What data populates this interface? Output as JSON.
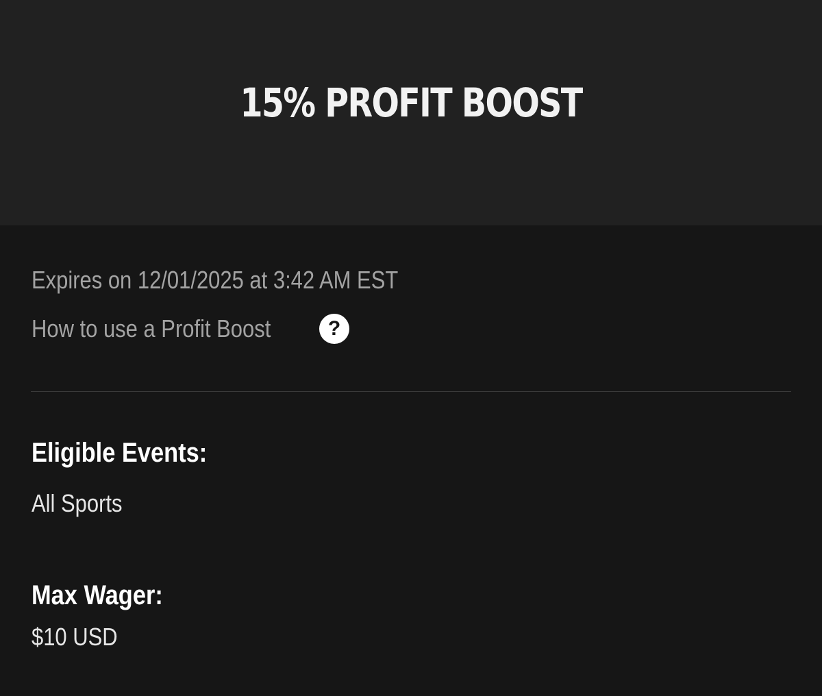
{
  "header": {
    "title": "15% PROFIT BOOST"
  },
  "details": {
    "expires_text": "Expires on 12/01/2025 at 3:42 AM EST",
    "how_to_text": "How to use a Profit Boost",
    "help_icon_glyph": "?",
    "help_icon_name": "question-circle-icon"
  },
  "eligible_events": {
    "label": "Eligible Events:",
    "value": "All Sports"
  },
  "max_wager": {
    "label": "Max Wager:",
    "value": "$10 USD"
  },
  "colors": {
    "header_bg": "#212121",
    "content_bg": "#161616",
    "muted_text": "#a3a3a3",
    "primary_text": "#ffffff"
  }
}
